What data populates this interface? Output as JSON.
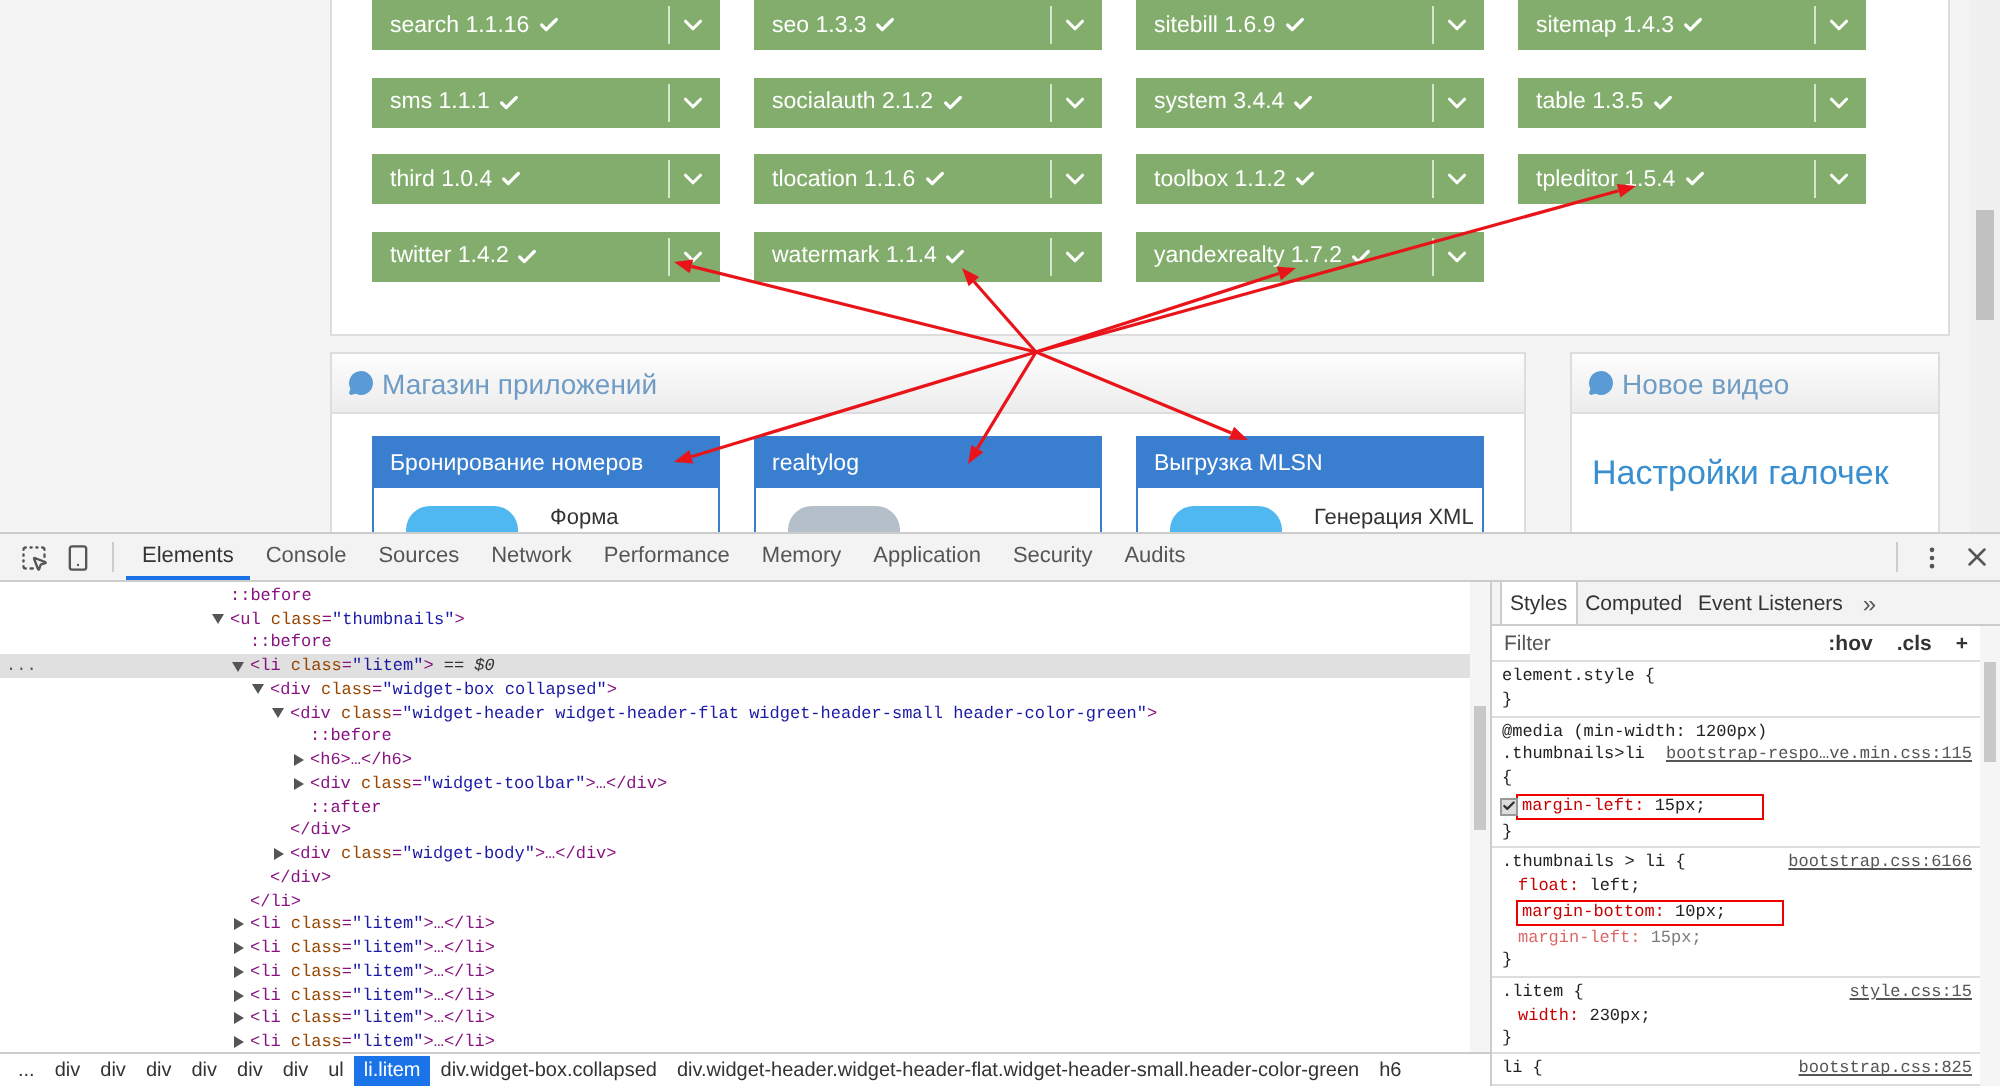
{
  "plugins": [
    {
      "label": "search 1.1.16"
    },
    {
      "label": "seo 1.3.3"
    },
    {
      "label": "sitebill 1.6.9"
    },
    {
      "label": "sitemap 1.4.3"
    },
    {
      "label": "sms 1.1.1"
    },
    {
      "label": "socialauth 2.1.2"
    },
    {
      "label": "system 3.4.4"
    },
    {
      "label": "table 1.3.5"
    },
    {
      "label": "third 1.0.4"
    },
    {
      "label": "tlocation 1.1.6"
    },
    {
      "label": "toolbox 1.1.2"
    },
    {
      "label": "tpleditor 1.5.4"
    },
    {
      "label": "twitter 1.4.2"
    },
    {
      "label": "watermark 1.1.4"
    },
    {
      "label": "yandexrealty 1.7.2"
    }
  ],
  "store": {
    "title": "Магазин приложений",
    "cards": [
      {
        "title": "Бронирование номеров",
        "text": "Форма",
        "color": "#4fb8f0"
      },
      {
        "title": "realtylog",
        "color": "#b4bfca"
      },
      {
        "title": "Выгрузка MLSN",
        "text": "Генерация XML",
        "color": "#4fb8f0"
      }
    ]
  },
  "video": {
    "title": "Новое видео",
    "link": "Настройки галочек"
  },
  "devtools": {
    "tabs": [
      {
        "label": "Elements",
        "selected": true
      },
      {
        "label": "Console",
        "selected": false
      },
      {
        "label": "Sources",
        "selected": false
      },
      {
        "label": "Network",
        "selected": false
      },
      {
        "label": "Performance",
        "selected": false
      },
      {
        "label": "Memory",
        "selected": false
      },
      {
        "label": "Application",
        "selected": false
      },
      {
        "label": "Security",
        "selected": false
      },
      {
        "label": "Audits",
        "selected": false
      }
    ],
    "dom": [
      {
        "text": "::before",
        "selected": false
      },
      {
        "text": "<ul class=\"thumbnails\">",
        "expanded": true,
        "selected": false,
        "children": [
          {
            "text": "::before",
            "selected": false
          },
          {
            "text": "<li class=\"litem\">",
            "suffix": "== $0",
            "gutter": "...",
            "expanded": true,
            "selected": true,
            "close": "</li>",
            "children": [
              {
                "text": "<div class=\"widget-box collapsed\">",
                "expanded": true,
                "selected": false,
                "close": "</div>",
                "children": [
                  {
                    "text": "<div class=\"widget-header widget-header-flat widget-header-small header-color-green\">",
                    "expanded": true,
                    "selected": false,
                    "close": "</div>",
                    "children": [
                      {
                        "text": "::before",
                        "selected": false
                      },
                      {
                        "text": "<h6>…</h6>",
                        "expanded": false,
                        "selected": false
                      },
                      {
                        "text": "<div class=\"widget-toolbar\">…</div>",
                        "expanded": false,
                        "selected": false
                      },
                      {
                        "text": "::after",
                        "selected": false
                      }
                    ]
                  },
                  {
                    "text": "<div class=\"widget-body\">…</div>",
                    "expanded": false,
                    "selected": false
                  }
                ]
              }
            ]
          },
          {
            "text": "<li class=\"litem\">…</li>",
            "expanded": false,
            "selected": false
          },
          {
            "text": "<li class=\"litem\">…</li>",
            "expanded": false,
            "selected": false
          },
          {
            "text": "<li class=\"litem\">…</li>",
            "expanded": false,
            "selected": false
          },
          {
            "text": "<li class=\"litem\">…</li>",
            "expanded": false,
            "selected": false
          },
          {
            "text": "<li class=\"litem\">…</li>",
            "expanded": false,
            "selected": false
          },
          {
            "text": "<li class=\"litem\">…</li>",
            "expanded": false,
            "selected": false
          }
        ]
      }
    ],
    "breadcrumbs": [
      {
        "label": "...",
        "selected": false
      },
      {
        "label": "div",
        "selected": false
      },
      {
        "label": "div",
        "selected": false
      },
      {
        "label": "div",
        "selected": false
      },
      {
        "label": "div",
        "selected": false
      },
      {
        "label": "div",
        "selected": false
      },
      {
        "label": "div",
        "selected": false
      },
      {
        "label": "ul",
        "selected": false
      },
      {
        "label": "li.litem",
        "selected": true
      },
      {
        "label": "div.widget-box.collapsed",
        "selected": false
      },
      {
        "label": "div.widget-header.widget-header-flat.widget-header-small.header-color-green",
        "selected": false
      },
      {
        "label": "h6",
        "selected": false
      }
    ],
    "styles": {
      "tabs": [
        {
          "label": "Styles",
          "selected": true
        },
        {
          "label": "Computed",
          "selected": false
        },
        {
          "label": "Event Listeners",
          "selected": false
        }
      ],
      "more": "»",
      "filter": {
        "placeholder": "Filter"
      },
      "hov": ":hov",
      "cls": ".cls",
      "add": "+",
      "rules": [
        {
          "selector": "element.style {",
          "close": "}"
        },
        {
          "media": "@media (min-width: 1200px)",
          "selector": ".thumbnails>li",
          "source": "bootstrap-respo…ve.min.css:115",
          "brace": "{",
          "props": [
            {
              "name": "margin-left:",
              "value": "15px;",
              "checked": true,
              "overridden": false,
              "boxed": true
            }
          ],
          "close": "}"
        },
        {
          "selector": ".thumbnails > li {",
          "source": "bootstrap.css:6166",
          "props": [
            {
              "name": "float:",
              "value": "left;",
              "overridden": false,
              "boxed": false
            },
            {
              "name": "margin-bottom:",
              "value": "10px;",
              "overridden": false,
              "boxed": true
            },
            {
              "name": "margin-left:",
              "value": "15px;",
              "overridden": true,
              "boxed": false
            }
          ],
          "close": "}"
        },
        {
          "selector": ".litem {",
          "source": "style.css:15",
          "props": [
            {
              "name": "width:",
              "value": "230px;",
              "overridden": false,
              "boxed": false
            }
          ],
          "close": "}"
        },
        {
          "selector": "li {",
          "source": "bootstrap.css:825"
        }
      ]
    }
  }
}
